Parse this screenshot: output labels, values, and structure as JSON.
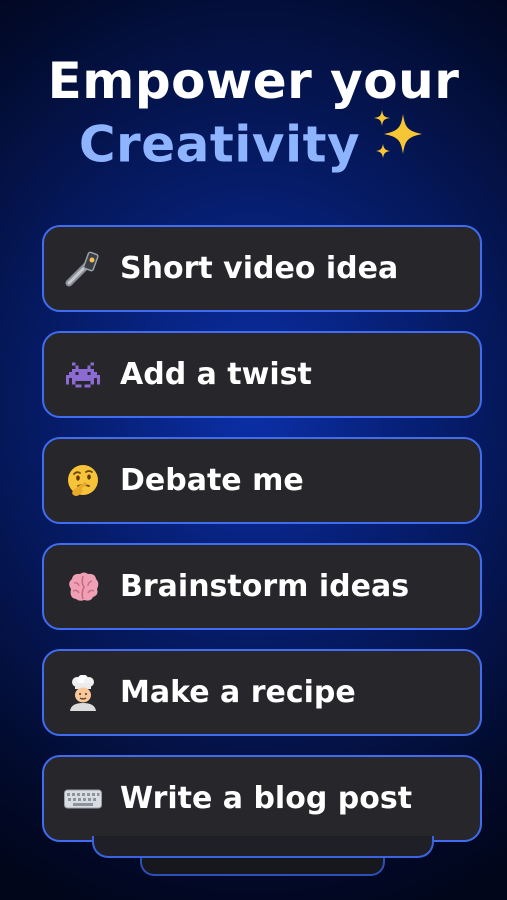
{
  "header": {
    "line1": "Empower your",
    "line2": "Creativity",
    "decoration_icon": "sparkles-icon"
  },
  "prompts": [
    {
      "label": "Short video idea",
      "icon": "selfie-icon"
    },
    {
      "label": "Add a twist",
      "icon": "space-invader-icon"
    },
    {
      "label": "Debate me",
      "icon": "thinking-face-icon"
    },
    {
      "label": "Brainstorm ideas",
      "icon": "brain-icon"
    },
    {
      "label": "Make a recipe",
      "icon": "cook-icon"
    },
    {
      "label": "Write a blog post",
      "icon": "keyboard-icon"
    }
  ],
  "colors": {
    "accent": "#8fb4ff",
    "chip_border": "#3f6cf0",
    "chip_bg": "#26262b"
  }
}
